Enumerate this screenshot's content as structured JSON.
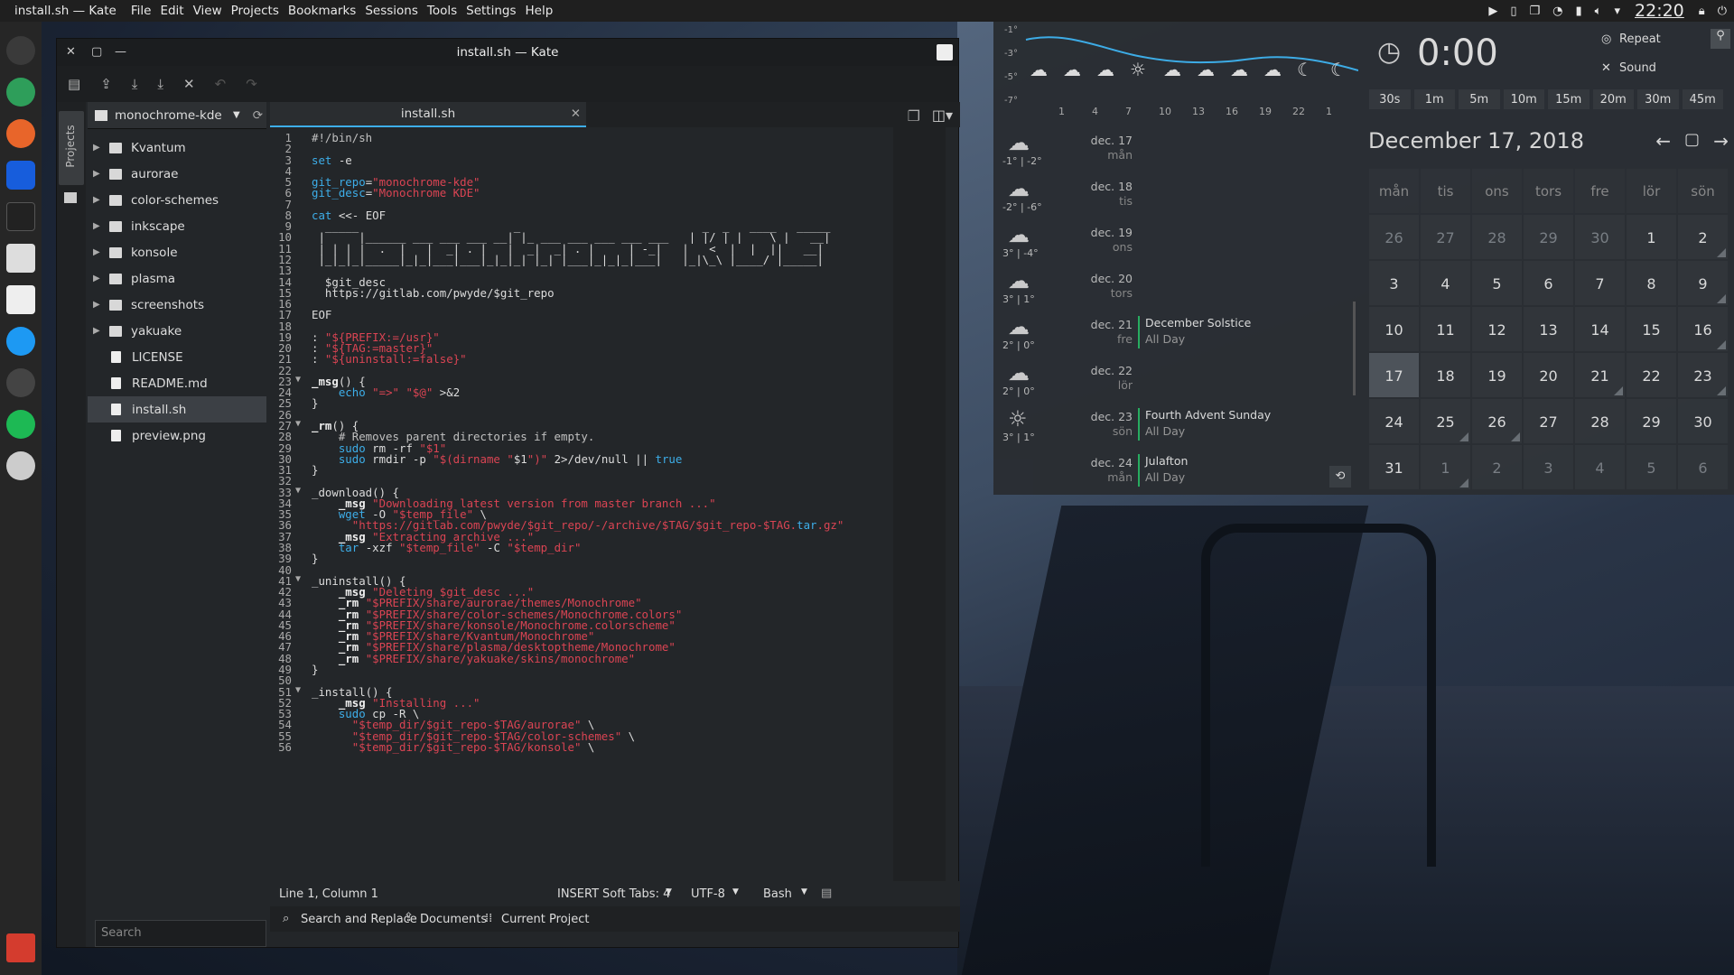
{
  "topbar": {
    "app": "install.sh — Kate",
    "menu": [
      "File",
      "Edit",
      "View",
      "Projects",
      "Bookmarks",
      "Sessions",
      "Tools",
      "Settings",
      "Help"
    ],
    "clock": "22:20"
  },
  "kate": {
    "title": "install.sh — Kate",
    "projects_tab": "Projects",
    "project": "monochrome-kde",
    "tree": [
      {
        "name": "Kvantum",
        "dir": true
      },
      {
        "name": "aurorae",
        "dir": true
      },
      {
        "name": "color-schemes",
        "dir": true
      },
      {
        "name": "inkscape",
        "dir": true
      },
      {
        "name": "konsole",
        "dir": true
      },
      {
        "name": "plasma",
        "dir": true
      },
      {
        "name": "screenshots",
        "dir": true
      },
      {
        "name": "yakuake",
        "dir": true
      },
      {
        "name": "LICENSE",
        "dir": false
      },
      {
        "name": "README.md",
        "dir": false
      },
      {
        "name": "install.sh",
        "dir": false,
        "selected": true
      },
      {
        "name": "preview.png",
        "dir": false
      }
    ],
    "search_placeholder": "Search",
    "tab": "install.sh",
    "code": [
      "#!/bin/sh",
      "",
      "set -e",
      "",
      "git_repo=\"monochrome-kde\"",
      "git_desc=\"Monochrome KDE\"",
      "",
      "cat <<- EOF",
      "  _____                       _                           _  _   ____   _____",
      " |     |______ ___ ___ ___ __| |_ ___ ___ ___ ___ ___   | |/ | |    \\ |   __|",
      " | | | |  .  |   |  _| . |   |  _|  _| . |     | -_|   |   <  |  |  ||   __|",
      " |_|_|_|_____|_|_|___|___|_|_|_| |_| |___|_|_|_|___|   |_|\\_\\ |____/ |_____|",
      "",
      "  $git_desc",
      "  https://gitlab.com/pwyde/$git_repo",
      "",
      "EOF",
      "",
      ": \"${PREFIX:=/usr}\"",
      ": \"${TAG:=master}\"",
      ": \"${uninstall:=false}\"",
      "",
      "_msg() {",
      "    echo \"=>\" \"$@\" >&2",
      "}",
      "",
      "_rm() {",
      "    # Removes parent directories if empty.",
      "    sudo rm -rf \"$1\"",
      "    sudo rmdir -p \"$(dirname \"$1\")\" 2>/dev/null || true",
      "}",
      "",
      "_download() {",
      "    _msg \"Downloading latest version from master branch ...\"",
      "    wget -O \"$temp_file\" \\",
      "      \"https://gitlab.com/pwyde/$git_repo/-/archive/$TAG/$git_repo-$TAG.tar.gz\"",
      "    _msg \"Extracting archive ...\"",
      "    tar -xzf \"$temp_file\" -C \"$temp_dir\"",
      "}",
      "",
      "_uninstall() {",
      "    _msg \"Deleting $git_desc ...\"",
      "    _rm \"$PREFIX/share/aurorae/themes/Monochrome\"",
      "    _rm \"$PREFIX/share/color-schemes/Monochrome.colors\"",
      "    _rm \"$PREFIX/share/konsole/Monochrome.colorscheme\"",
      "    _rm \"$PREFIX/share/Kvantum/Monochrome\"",
      "    _rm \"$PREFIX/share/plasma/desktoptheme/Monochrome\"",
      "    _rm \"$PREFIX/share/yakuake/skins/monochrome\"",
      "}",
      "",
      "_install() {",
      "    _msg \"Installing ...\"",
      "    sudo cp -R \\",
      "      \"$temp_dir/$git_repo-$TAG/aurorae\" \\",
      "      \"$temp_dir/$git_repo-$TAG/color-schemes\" \\",
      "      \"$temp_dir/$git_repo-$TAG/konsole\" \\"
    ],
    "status": {
      "position": "Line 1, Column 1",
      "mode": "INSERT",
      "tabs": "Soft Tabs: 4",
      "encoding": "UTF-8",
      "syntax": "Bash"
    },
    "bottom": {
      "search": "Search and Replace",
      "documents": "Documents",
      "project": "Current Project"
    }
  },
  "weather": {
    "y_ticks": [
      "-1°",
      "-3°",
      "-5°",
      "-7°"
    ],
    "x_ticks": [
      "1",
      "4",
      "7",
      "10",
      "13",
      "16",
      "19",
      "22",
      "1"
    ],
    "forecast": [
      {
        "date": "dec. 17",
        "weekday": "mån",
        "temp": "-1° | -2°",
        "icon": "snow-cloud-icon"
      },
      {
        "date": "dec. 18",
        "weekday": "tis",
        "temp": "-2° | -6°",
        "icon": "snow-cloud-icon"
      },
      {
        "date": "dec. 19",
        "weekday": "ons",
        "temp": "3° | -4°",
        "icon": "snow-cloud-icon"
      },
      {
        "date": "dec. 20",
        "weekday": "tors",
        "temp": "3° | 1°",
        "icon": "snow-cloud-icon"
      },
      {
        "date": "dec. 21",
        "weekday": "fre",
        "temp": "2° | 0°",
        "icon": "snow-cloud-icon",
        "event": "December Solstice",
        "event_time": "All Day"
      },
      {
        "date": "dec. 22",
        "weekday": "lör",
        "temp": "2° | 0°",
        "icon": "rain-cloud-icon"
      },
      {
        "date": "dec. 23",
        "weekday": "sön",
        "temp": "3° | 1°",
        "icon": "sun-icon",
        "event": "Fourth Advent Sunday",
        "event_time": "All Day"
      },
      {
        "date": "dec. 24",
        "weekday": "mån",
        "temp": "",
        "icon": "",
        "event": "Julafton",
        "event_time": "All Day"
      }
    ]
  },
  "timer": {
    "display": "0:00",
    "repeat": "Repeat",
    "sound": "Sound",
    "presets": [
      "30s",
      "1m",
      "5m",
      "10m",
      "15m",
      "20m",
      "30m",
      "45m"
    ]
  },
  "calendar": {
    "title": "December 17, 2018",
    "weekdays": [
      "mån",
      "tis",
      "ons",
      "tors",
      "fre",
      "lör",
      "sön"
    ],
    "days": [
      {
        "d": "26",
        "o": 1
      },
      {
        "d": "27",
        "o": 1
      },
      {
        "d": "28",
        "o": 1
      },
      {
        "d": "29",
        "o": 1
      },
      {
        "d": "30",
        "o": 1
      },
      {
        "d": "1"
      },
      {
        "d": "2",
        "e": 1
      },
      {
        "d": "3"
      },
      {
        "d": "4"
      },
      {
        "d": "5"
      },
      {
        "d": "6"
      },
      {
        "d": "7"
      },
      {
        "d": "8"
      },
      {
        "d": "9",
        "e": 1
      },
      {
        "d": "10"
      },
      {
        "d": "11"
      },
      {
        "d": "12"
      },
      {
        "d": "13"
      },
      {
        "d": "14"
      },
      {
        "d": "15"
      },
      {
        "d": "16",
        "e": 1
      },
      {
        "d": "17",
        "t": 1
      },
      {
        "d": "18"
      },
      {
        "d": "19"
      },
      {
        "d": "20"
      },
      {
        "d": "21",
        "e": 1
      },
      {
        "d": "22"
      },
      {
        "d": "23",
        "e": 1
      },
      {
        "d": "24"
      },
      {
        "d": "25",
        "e": 1
      },
      {
        "d": "26",
        "e": 1
      },
      {
        "d": "27"
      },
      {
        "d": "28"
      },
      {
        "d": "29"
      },
      {
        "d": "30"
      },
      {
        "d": "31"
      },
      {
        "d": "1",
        "o": 1,
        "e": 1
      },
      {
        "d": "2",
        "o": 1
      },
      {
        "d": "3",
        "o": 1
      },
      {
        "d": "4",
        "o": 1
      },
      {
        "d": "5",
        "o": 1
      },
      {
        "d": "6",
        "o": 1
      }
    ]
  }
}
